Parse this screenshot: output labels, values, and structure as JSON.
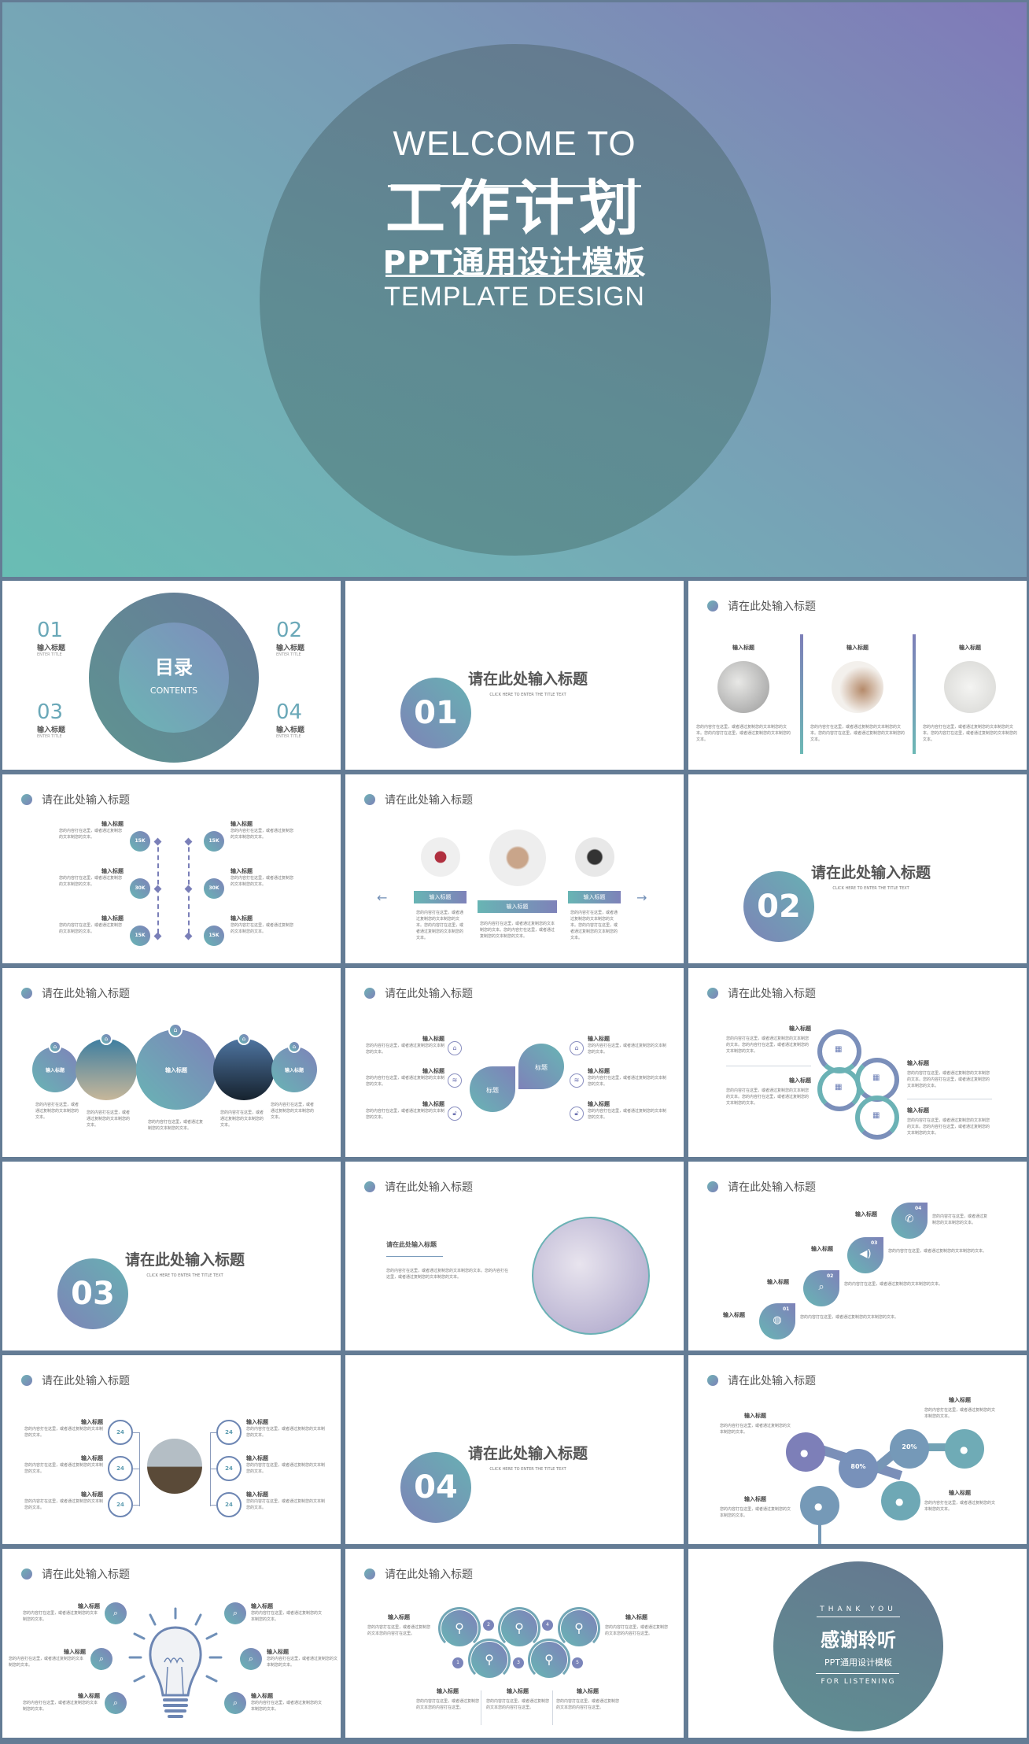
{
  "colors": {
    "frame": "#647c95",
    "teal": "#69bdb4",
    "purple": "#8079b8",
    "circle": "#61838f"
  },
  "cover": {
    "welcome": "WELCOME TO",
    "title": "工作计划",
    "subtitle": "PPT通用设计模板",
    "template": "TEMPLATE DESIGN"
  },
  "slide_title": "请在此处输入标题",
  "item_title": "输入标题",
  "contents": {
    "title": "目录",
    "subtitle": "CONTENTS",
    "items": [
      {
        "num": "01",
        "title": "输入标题",
        "en": "ENTER TITLE"
      },
      {
        "num": "02",
        "title": "输入标题",
        "en": "ENTER TITLE"
      },
      {
        "num": "03",
        "title": "输入标题",
        "en": "ENTER TITLE"
      },
      {
        "num": "04",
        "title": "输入标题",
        "en": "ENTER TITLE"
      }
    ]
  },
  "sections": [
    {
      "num": "01",
      "title": "请在此处输入标题",
      "sub": "CLICK HERE TO ENTER THE TITLE TEXT"
    },
    {
      "num": "02",
      "title": "请在此处输入标题",
      "sub": "CLICK HERE TO ENTER THE TITLE TEXT"
    },
    {
      "num": "03",
      "title": "请在此处输入标题",
      "sub": "CLICK HERE TO ENTER THE TITLE TEXT"
    },
    {
      "num": "04",
      "title": "请在此处输入标题",
      "sub": "CLICK HERE TO ENTER THE TITLE TEXT"
    }
  ],
  "body_text": {
    "long": "您的内容打在这里，或者通过复制您的文本制您的文本。您的内容打在这里，或者通过复制您的文本制您的文本。",
    "short": "您的内容打在这里，或者通过复制您的文本制您的文本。",
    "mid": "您的内容打在这里，或者通过复制您的文本您的内容打在这里。"
  },
  "timeline": {
    "left": [
      "15K",
      "30K",
      "15K"
    ],
    "right": [
      "15K",
      "30K",
      "15K"
    ]
  },
  "drops": {
    "labels": [
      "标题",
      "标题"
    ]
  },
  "steps": [
    "01",
    "02",
    "03",
    "04"
  ],
  "bubbles": [
    "80%",
    "20%"
  ],
  "numbers5": [
    "1",
    "2",
    "3",
    "4",
    "5"
  ],
  "badge24": "24",
  "thanks": {
    "en": "THANK YOU",
    "title": "感谢聆听",
    "subtitle": "PPT通用设计模板",
    "foot": "FOR LISTENING"
  }
}
